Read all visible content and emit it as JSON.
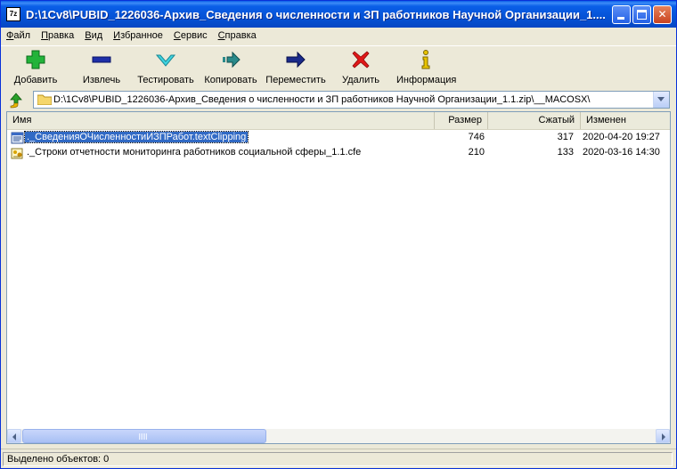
{
  "window": {
    "title": "D:\\1Cv8\\PUBID_1226036-Архив_Сведения о численности и ЗП работников Научной Организации_1....",
    "app_icon_text": "7z"
  },
  "menu": [
    {
      "accel": "Ф",
      "rest": "айл"
    },
    {
      "accel": "П",
      "rest": "равка"
    },
    {
      "accel": "В",
      "rest": "ид"
    },
    {
      "accel": "И",
      "rest": "збранное"
    },
    {
      "accel": "С",
      "rest": "ервис"
    },
    {
      "accel": "С",
      "rest": "правка"
    }
  ],
  "toolbar": {
    "add": "Добавить",
    "extract": "Извлечь",
    "test": "Тестировать",
    "copy": "Копировать",
    "move": "Переместить",
    "delete": "Удалить",
    "info": "Информация"
  },
  "address": {
    "path": "D:\\1Cv8\\PUBID_1226036-Архив_Сведения о численности и ЗП работников Научной Организации_1.1.zip\\__MACOSX\\"
  },
  "columns": {
    "name": "Имя",
    "size": "Размер",
    "packed": "Сжатый",
    "modified": "Изменен"
  },
  "files": [
    {
      "name": "._СведенияОЧисленностиИЗПРабот.textClipping",
      "size": "746",
      "packed": "317",
      "modified": "2020-04-20 19:27",
      "selected": true,
      "icon": "text-file-icon"
    },
    {
      "name": "._Строки отчетности мониторинга работников социальной сферы_1.1.cfe",
      "size": "210",
      "packed": "133",
      "modified": "2020-03-16 14:30",
      "selected": false,
      "icon": "config-file-icon"
    }
  ],
  "status": {
    "text": "Выделено объектов: 0"
  },
  "colors": {
    "titlebar": "#0553d6",
    "selection": "#316ac5",
    "window_bg": "#ece9d8"
  }
}
